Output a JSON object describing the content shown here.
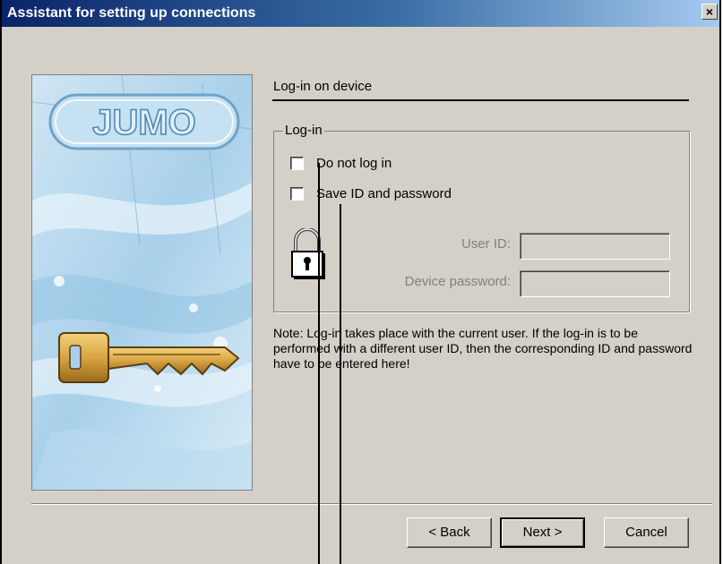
{
  "window": {
    "title": "Assistant for setting up connections",
    "close_glyph": "×"
  },
  "image": {
    "logo_text": "JUMO"
  },
  "section": {
    "heading": "Log-in on device"
  },
  "login_group": {
    "label": "Log-in",
    "do_not_log_in_label": "Do not log in",
    "do_not_log_in_checked": false,
    "save_id_label": "Save ID and password",
    "save_id_checked": false,
    "lock_icon": "padlock-icon",
    "user_id_label": "User ID:",
    "user_id_value": "",
    "device_password_label": "Device password:",
    "device_password_value": ""
  },
  "note": "Note: Log-in takes place with the current user. If the log-in is to be performed with a different user ID, then the corresponding ID and password have to be entered here!",
  "buttons": {
    "back": "< Back",
    "next": "Next >",
    "cancel": "Cancel"
  },
  "colors": {
    "title_start": "#0a246a",
    "title_end": "#a6caf0",
    "dialog_face": "#d4d0c8",
    "key_gold": "#d9a443"
  }
}
